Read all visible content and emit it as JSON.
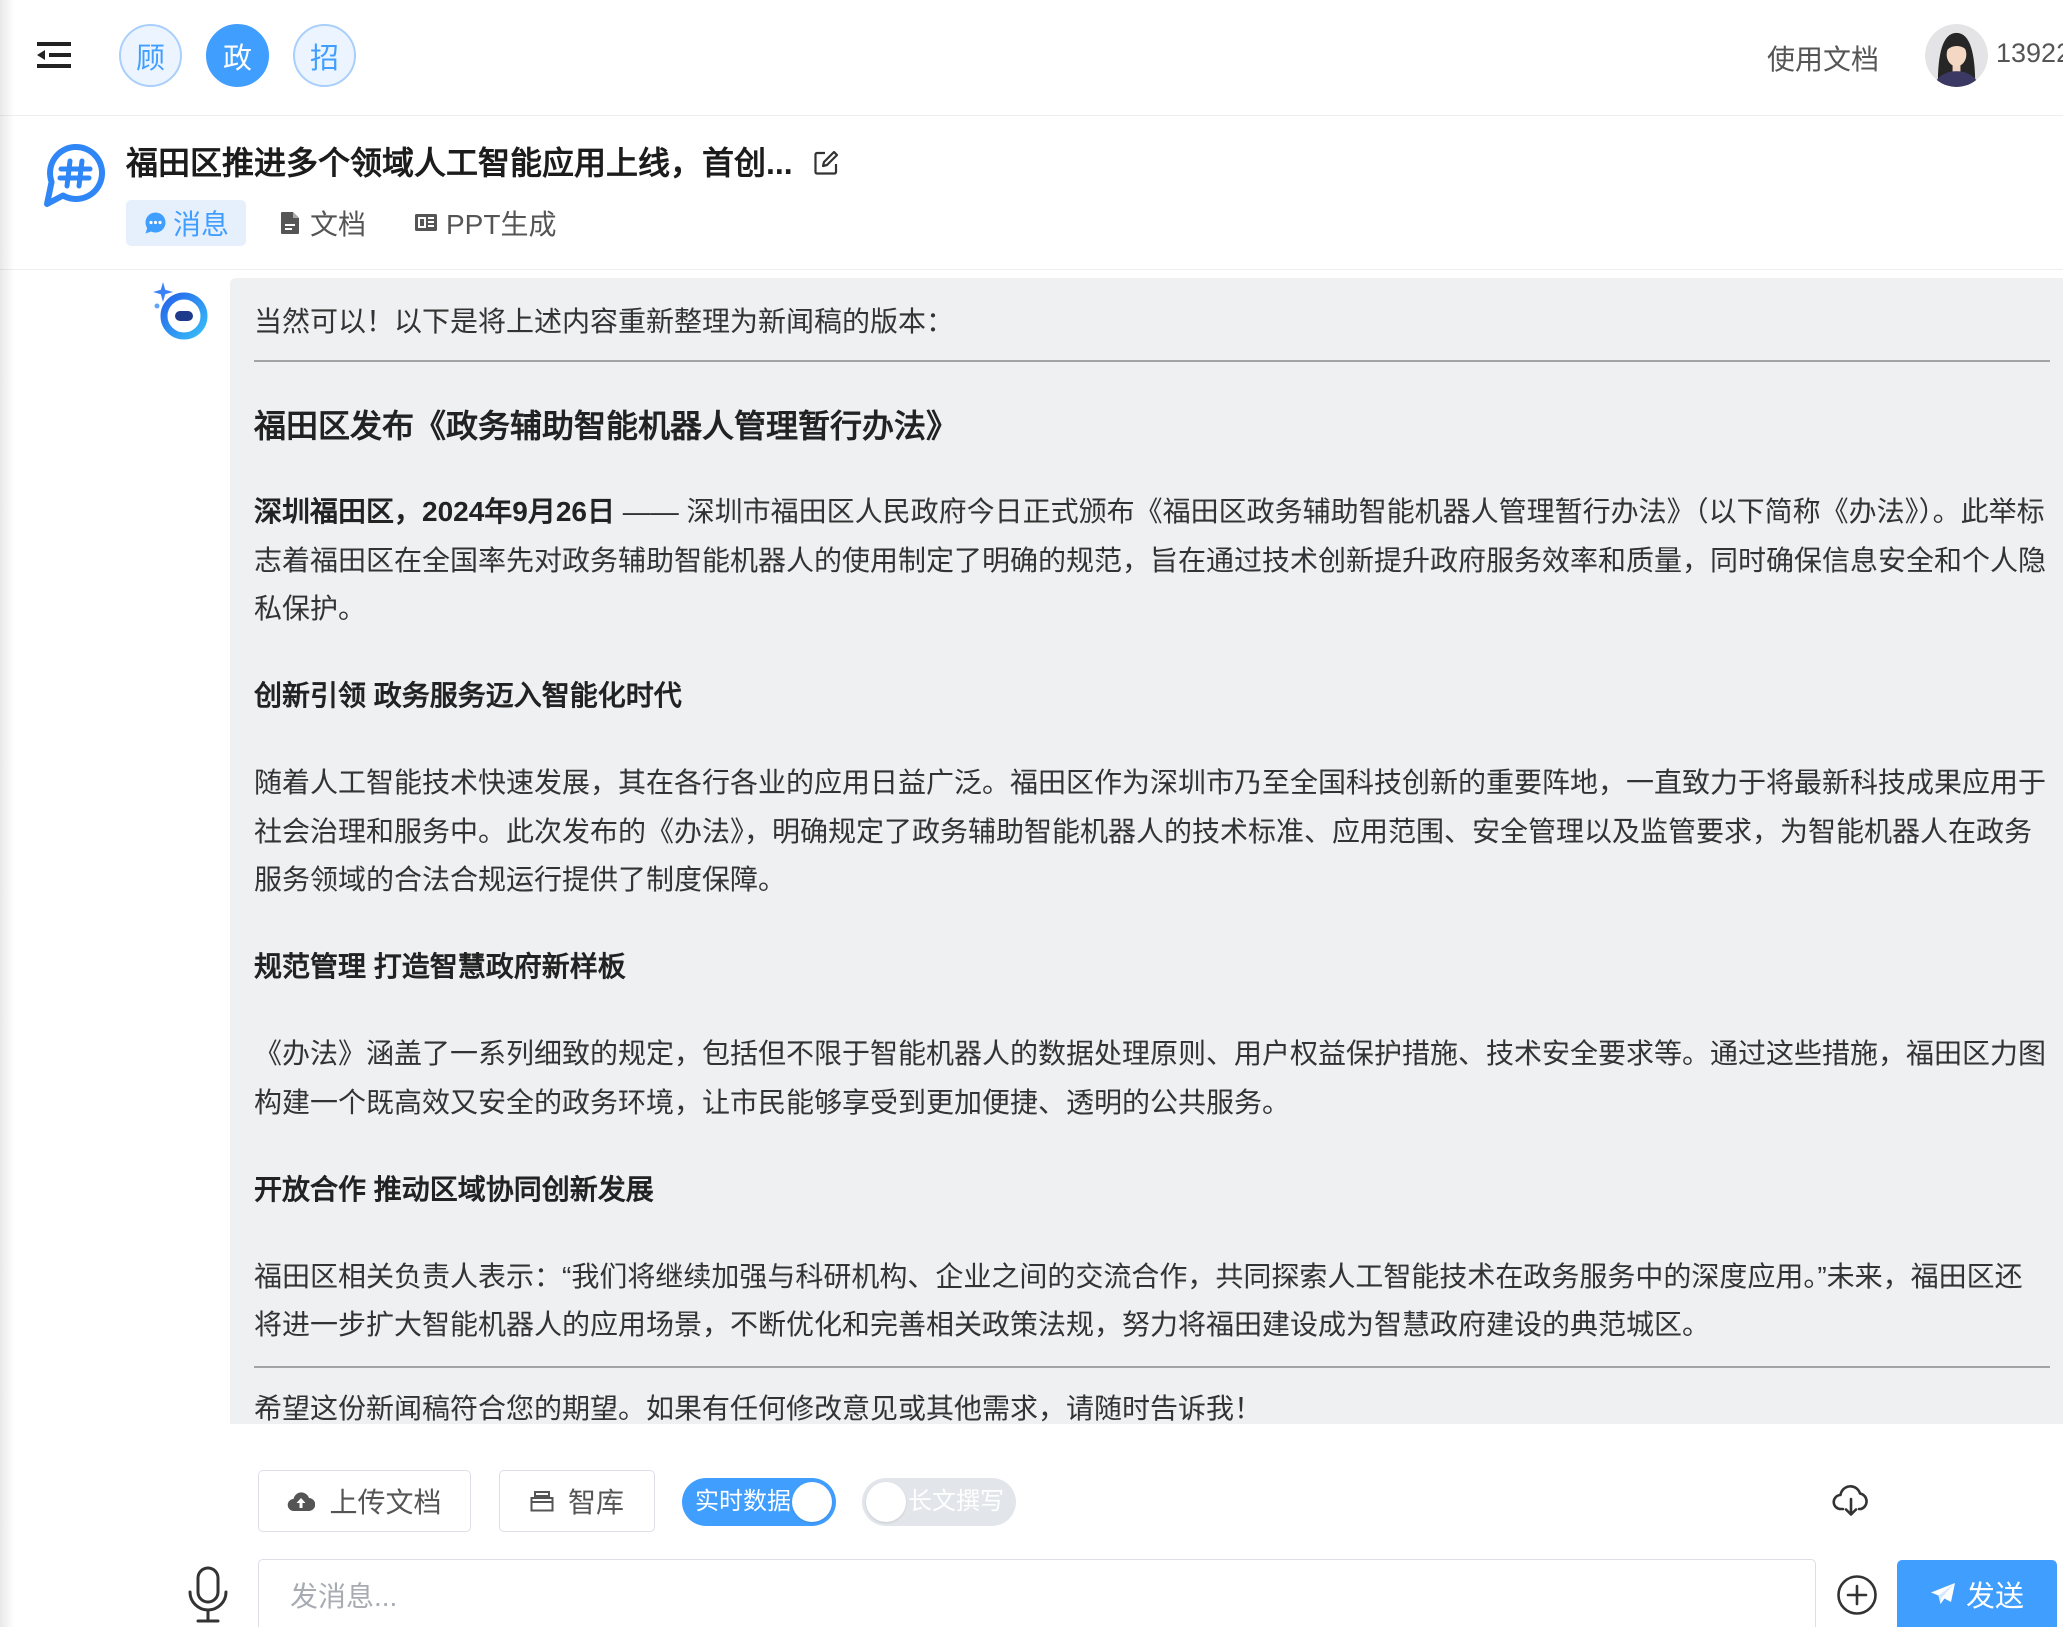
{
  "header": {
    "menu_icon": "menu-fold-icon",
    "modes": [
      {
        "label": "顾",
        "active": false
      },
      {
        "label": "政",
        "active": true
      },
      {
        "label": "招",
        "active": false
      }
    ],
    "docs_link": "使用文档",
    "avatar_icon": "user-avatar",
    "user_name": "13922"
  },
  "chat": {
    "icon": "hash-chat-icon",
    "title": "福田区推进多个领域人工智能应用上线，首创...",
    "edit_icon": "edit-icon",
    "tabs": [
      {
        "label": "消息",
        "icon": "chat-bubble-icon",
        "active": true
      },
      {
        "label": "文档",
        "icon": "document-icon",
        "active": false
      },
      {
        "label": "PPT生成",
        "icon": "presentation-icon",
        "active": false
      }
    ]
  },
  "message": {
    "author_icon": "bot-avatar-icon",
    "intro": "当然可以！以下是将上述内容重新整理为新闻稿的版本：",
    "headline": "福田区发布《政务辅助智能机器人管理暂行办法》",
    "lead_bold": "深圳福田区，2024年9月26日",
    "lead_rest": " —— 深圳市福田区人民政府今日正式颁布《福田区政务辅助智能机器人管理暂行办法》（以下简称《办法》）。此举标志着福田区在全国率先对政务辅助智能机器人的使用制定了明确的规范，旨在通过技术创新提升政府服务效率和质量，同时确保信息安全和个人隐私保护。",
    "sections": [
      {
        "heading": "创新引领 政务服务迈入智能化时代",
        "body": "随着人工智能技术快速发展，其在各行各业的应用日益广泛。福田区作为深圳市乃至全国科技创新的重要阵地，一直致力于将最新科技成果应用于社会治理和服务中。此次发布的《办法》，明确规定了政务辅助智能机器人的技术标准、应用范围、安全管理以及监管要求，为智能机器人在政务服务领域的合法合规运行提供了制度保障。"
      },
      {
        "heading": "规范管理 打造智慧政府新样板",
        "body": "《办法》涵盖了一系列细致的规定，包括但不限于智能机器人的数据处理原则、用户权益保护措施、技术安全要求等。通过这些措施，福田区力图构建一个既高效又安全的政务环境，让市民能够享受到更加便捷、透明的公共服务。"
      },
      {
        "heading": "开放合作 推动区域协同创新发展",
        "body": "福田区相关负责人表示：“我们将继续加强与科研机构、企业之间的交流合作，共同探索人工智能技术在政务服务中的深度应用。”未来，福田区还将进一步扩大智能机器人的应用场景，不断优化和完善相关政策法规，努力将福田建设成为智慧政府建设的典范城区。"
      }
    ],
    "closing": "希望这份新闻稿符合您的期望。如果有任何修改意见或其他需求，请随时告诉我！"
  },
  "toolbar": {
    "upload": {
      "label": "上传文档",
      "icon": "cloud-upload-icon"
    },
    "library": {
      "label": "智库",
      "icon": "archive-box-icon"
    },
    "realtime_toggle": {
      "label": "实时数据",
      "on": true
    },
    "longform_toggle": {
      "label": "长文撰写",
      "on": false
    },
    "download_icon": "cloud-download-icon"
  },
  "composer": {
    "mic_icon": "microphone-icon",
    "placeholder": "发消息...",
    "value": "",
    "attach_icon": "plus-circle-icon",
    "send_label": "发送",
    "send_icon": "paper-plane-icon"
  },
  "colors": {
    "accent": "#409eff",
    "accent_light": "#ecf5ff",
    "bubble": "#eff0f2",
    "text": "#333333"
  }
}
